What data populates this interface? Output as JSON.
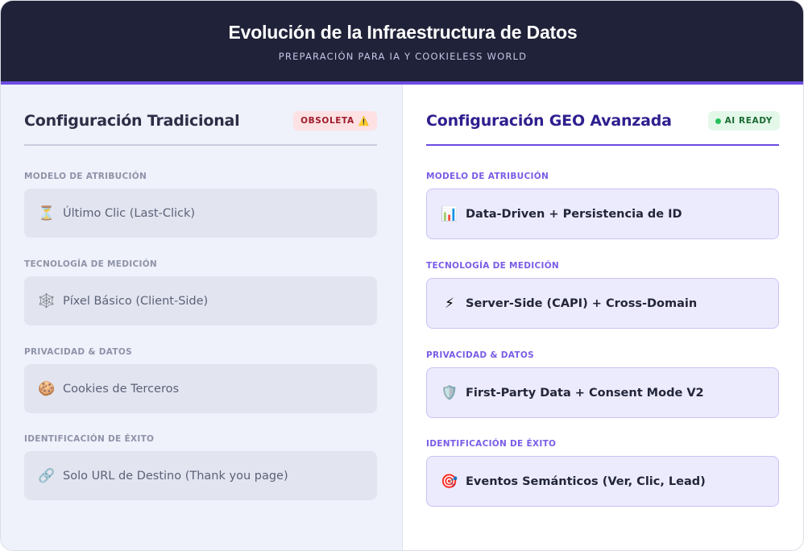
{
  "header": {
    "title": "Evolución de la Infraestructura de Datos",
    "subtitle": "PREPARACIÓN PARA IA Y COOKIELESS WORLD"
  },
  "left": {
    "title": "Configuración Tradicional",
    "badge": "OBSOLETA",
    "badge_icon": "warning-icon",
    "sections": [
      {
        "label": "MODELO DE ATRIBUCIÓN",
        "icon": "hourglass-icon",
        "text": "Último Clic (Last-Click)"
      },
      {
        "label": "TECNOLOGÍA DE MEDICIÓN",
        "icon": "spiderweb-icon",
        "text": "Píxel Básico (Client-Side)"
      },
      {
        "label": "PRIVACIDAD & DATOS",
        "icon": "cookie-icon",
        "text": "Cookies de Terceros"
      },
      {
        "label": "IDENTIFICACIÓN DE ÉXITO",
        "icon": "link-icon",
        "text": "Solo URL de Destino (Thank you page)"
      }
    ]
  },
  "right": {
    "title": "Configuración GEO Avanzada",
    "badge": "AI READY",
    "badge_color": "#27c15a",
    "sections": [
      {
        "label": "MODELO DE ATRIBUCIÓN",
        "icon": "bar-chart-icon",
        "text": "Data-Driven + Persistencia de ID"
      },
      {
        "label": "TECNOLOGÍA DE MEDICIÓN",
        "icon": "lightning-icon",
        "text": "Server-Side (CAPI) + Cross-Domain"
      },
      {
        "label": "PRIVACIDAD & DATOS",
        "icon": "shield-icon",
        "text": "First-Party Data + Consent Mode V2"
      },
      {
        "label": "IDENTIFICACIÓN DE ÉXITO",
        "icon": "target-icon",
        "text": "Eventos Semánticos (Ver, Clic, Lead)"
      }
    ]
  },
  "colors": {
    "header_bg": "#1f2238",
    "accent": "#6c4ce0",
    "obsolete_bg": "#fde1e3",
    "ready_bg": "#e4f8ea"
  }
}
